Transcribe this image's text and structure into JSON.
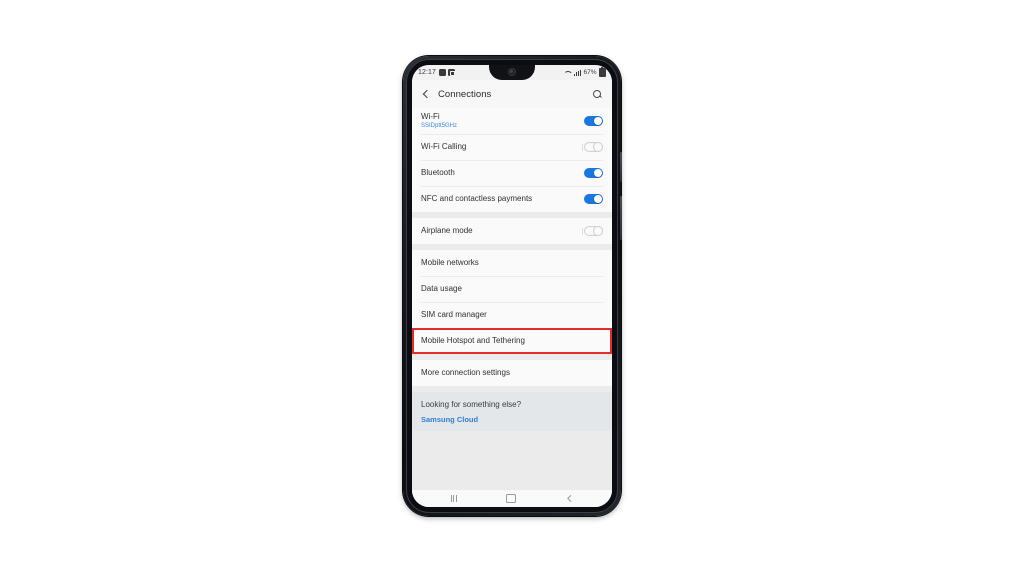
{
  "colors": {
    "accent_blue": "#1877e0",
    "link_blue": "#2f7fd4",
    "ssid_blue": "#3f8ae0",
    "highlight_red": "#e52b2b",
    "screen_bg": "#f7f7f7",
    "card_bg": "#fafafa",
    "gap_bg": "#ebebeb",
    "promo_bg": "#e3e7ea"
  },
  "status_bar": {
    "time": "12:17",
    "left_icons": [
      "screen-record-icon",
      "app-badge-icon"
    ],
    "right_icons": [
      "wifi-icon",
      "cellular-signal-icon"
    ],
    "battery_percent": "67%"
  },
  "app_bar": {
    "back_icon": "chevron-left-icon",
    "title": "Connections",
    "search_icon": "search-icon"
  },
  "sections": [
    {
      "name": "wireless",
      "rows": [
        {
          "title": "Wi-Fi",
          "subtitle": "SSIDptt5GHz",
          "control": "toggle",
          "state": "on"
        },
        {
          "title": "Wi-Fi Calling",
          "subtitle": "",
          "control": "toggle",
          "state": "off"
        },
        {
          "title": "Bluetooth",
          "subtitle": "",
          "control": "toggle",
          "state": "on"
        },
        {
          "title": "NFC and contactless payments",
          "subtitle": "",
          "control": "toggle",
          "state": "on"
        }
      ]
    },
    {
      "name": "airplane",
      "rows": [
        {
          "title": "Airplane mode",
          "subtitle": "",
          "control": "toggle",
          "state": "off"
        }
      ]
    },
    {
      "name": "mobile",
      "rows": [
        {
          "title": "Mobile networks",
          "subtitle": "",
          "control": "none",
          "state": ""
        },
        {
          "title": "Data usage",
          "subtitle": "",
          "control": "none",
          "state": ""
        },
        {
          "title": "SIM card manager",
          "subtitle": "",
          "control": "none",
          "state": ""
        },
        {
          "title": "Mobile Hotspot and Tethering",
          "subtitle": "",
          "control": "none",
          "state": "",
          "highlighted": true
        }
      ]
    },
    {
      "name": "more",
      "rows": [
        {
          "title": "More connection settings",
          "subtitle": "",
          "control": "none",
          "state": ""
        }
      ]
    }
  ],
  "promo": {
    "title": "Looking for something else?",
    "link": "Samsung Cloud"
  },
  "nav_bar": {
    "recents_icon": "recents-icon",
    "home_icon": "home-icon",
    "back_icon": "back-icon"
  }
}
